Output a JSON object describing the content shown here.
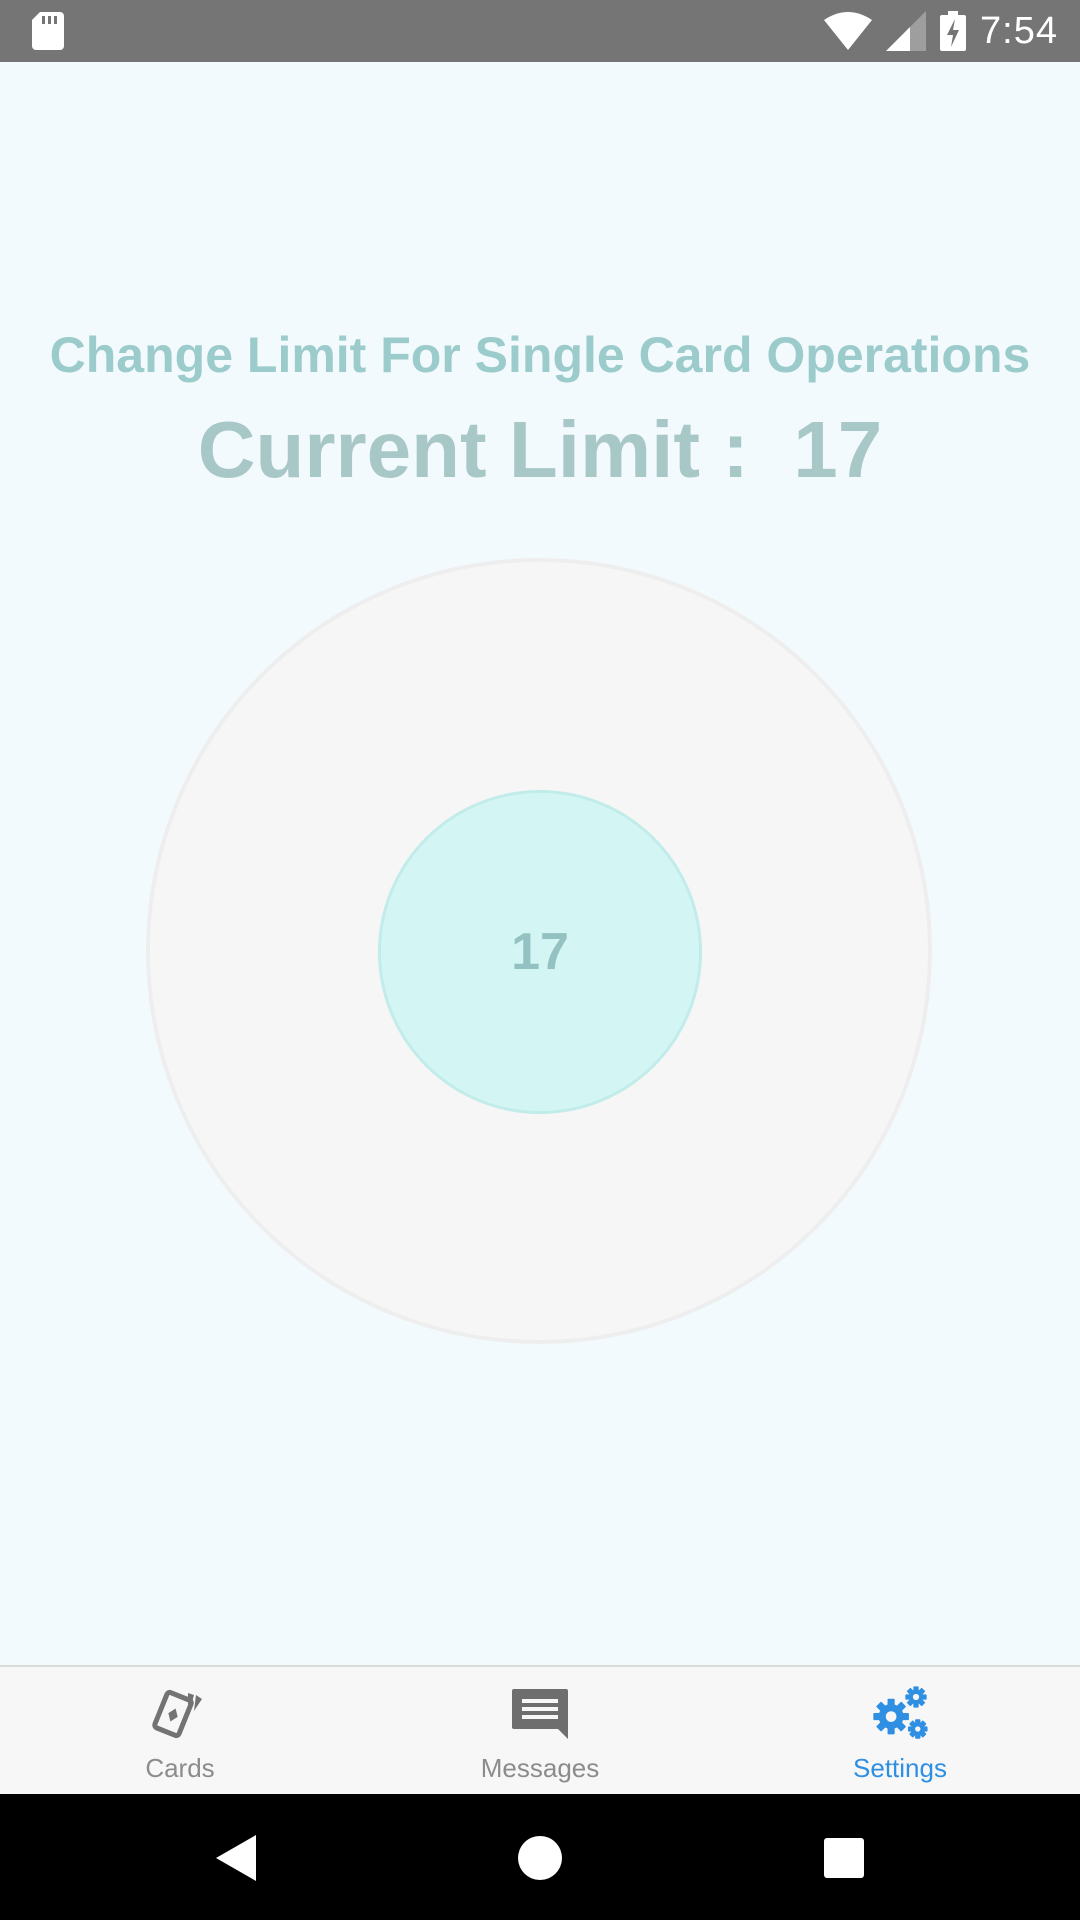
{
  "status_bar": {
    "time": "7:54",
    "icons": [
      "sd-card-icon",
      "wifi-icon",
      "cell-signal-icon",
      "battery-charging-icon"
    ]
  },
  "limit_screen": {
    "heading": "Change Limit For Single Card Operations",
    "current_limit_label": "Current Limit :",
    "current_limit_value": "17",
    "dial_value": "17"
  },
  "bottom_nav": {
    "items": [
      {
        "label": "Cards",
        "icon": "cards-icon",
        "active": false
      },
      {
        "label": "Messages",
        "icon": "message-icon",
        "active": false
      },
      {
        "label": "Settings",
        "icon": "gears-icon",
        "active": true
      }
    ]
  },
  "colors": {
    "accent": "#2f8fe3",
    "heading": "#9ccbcb",
    "dial_fill": "#d3f6f4",
    "background": "#f3fafd"
  }
}
